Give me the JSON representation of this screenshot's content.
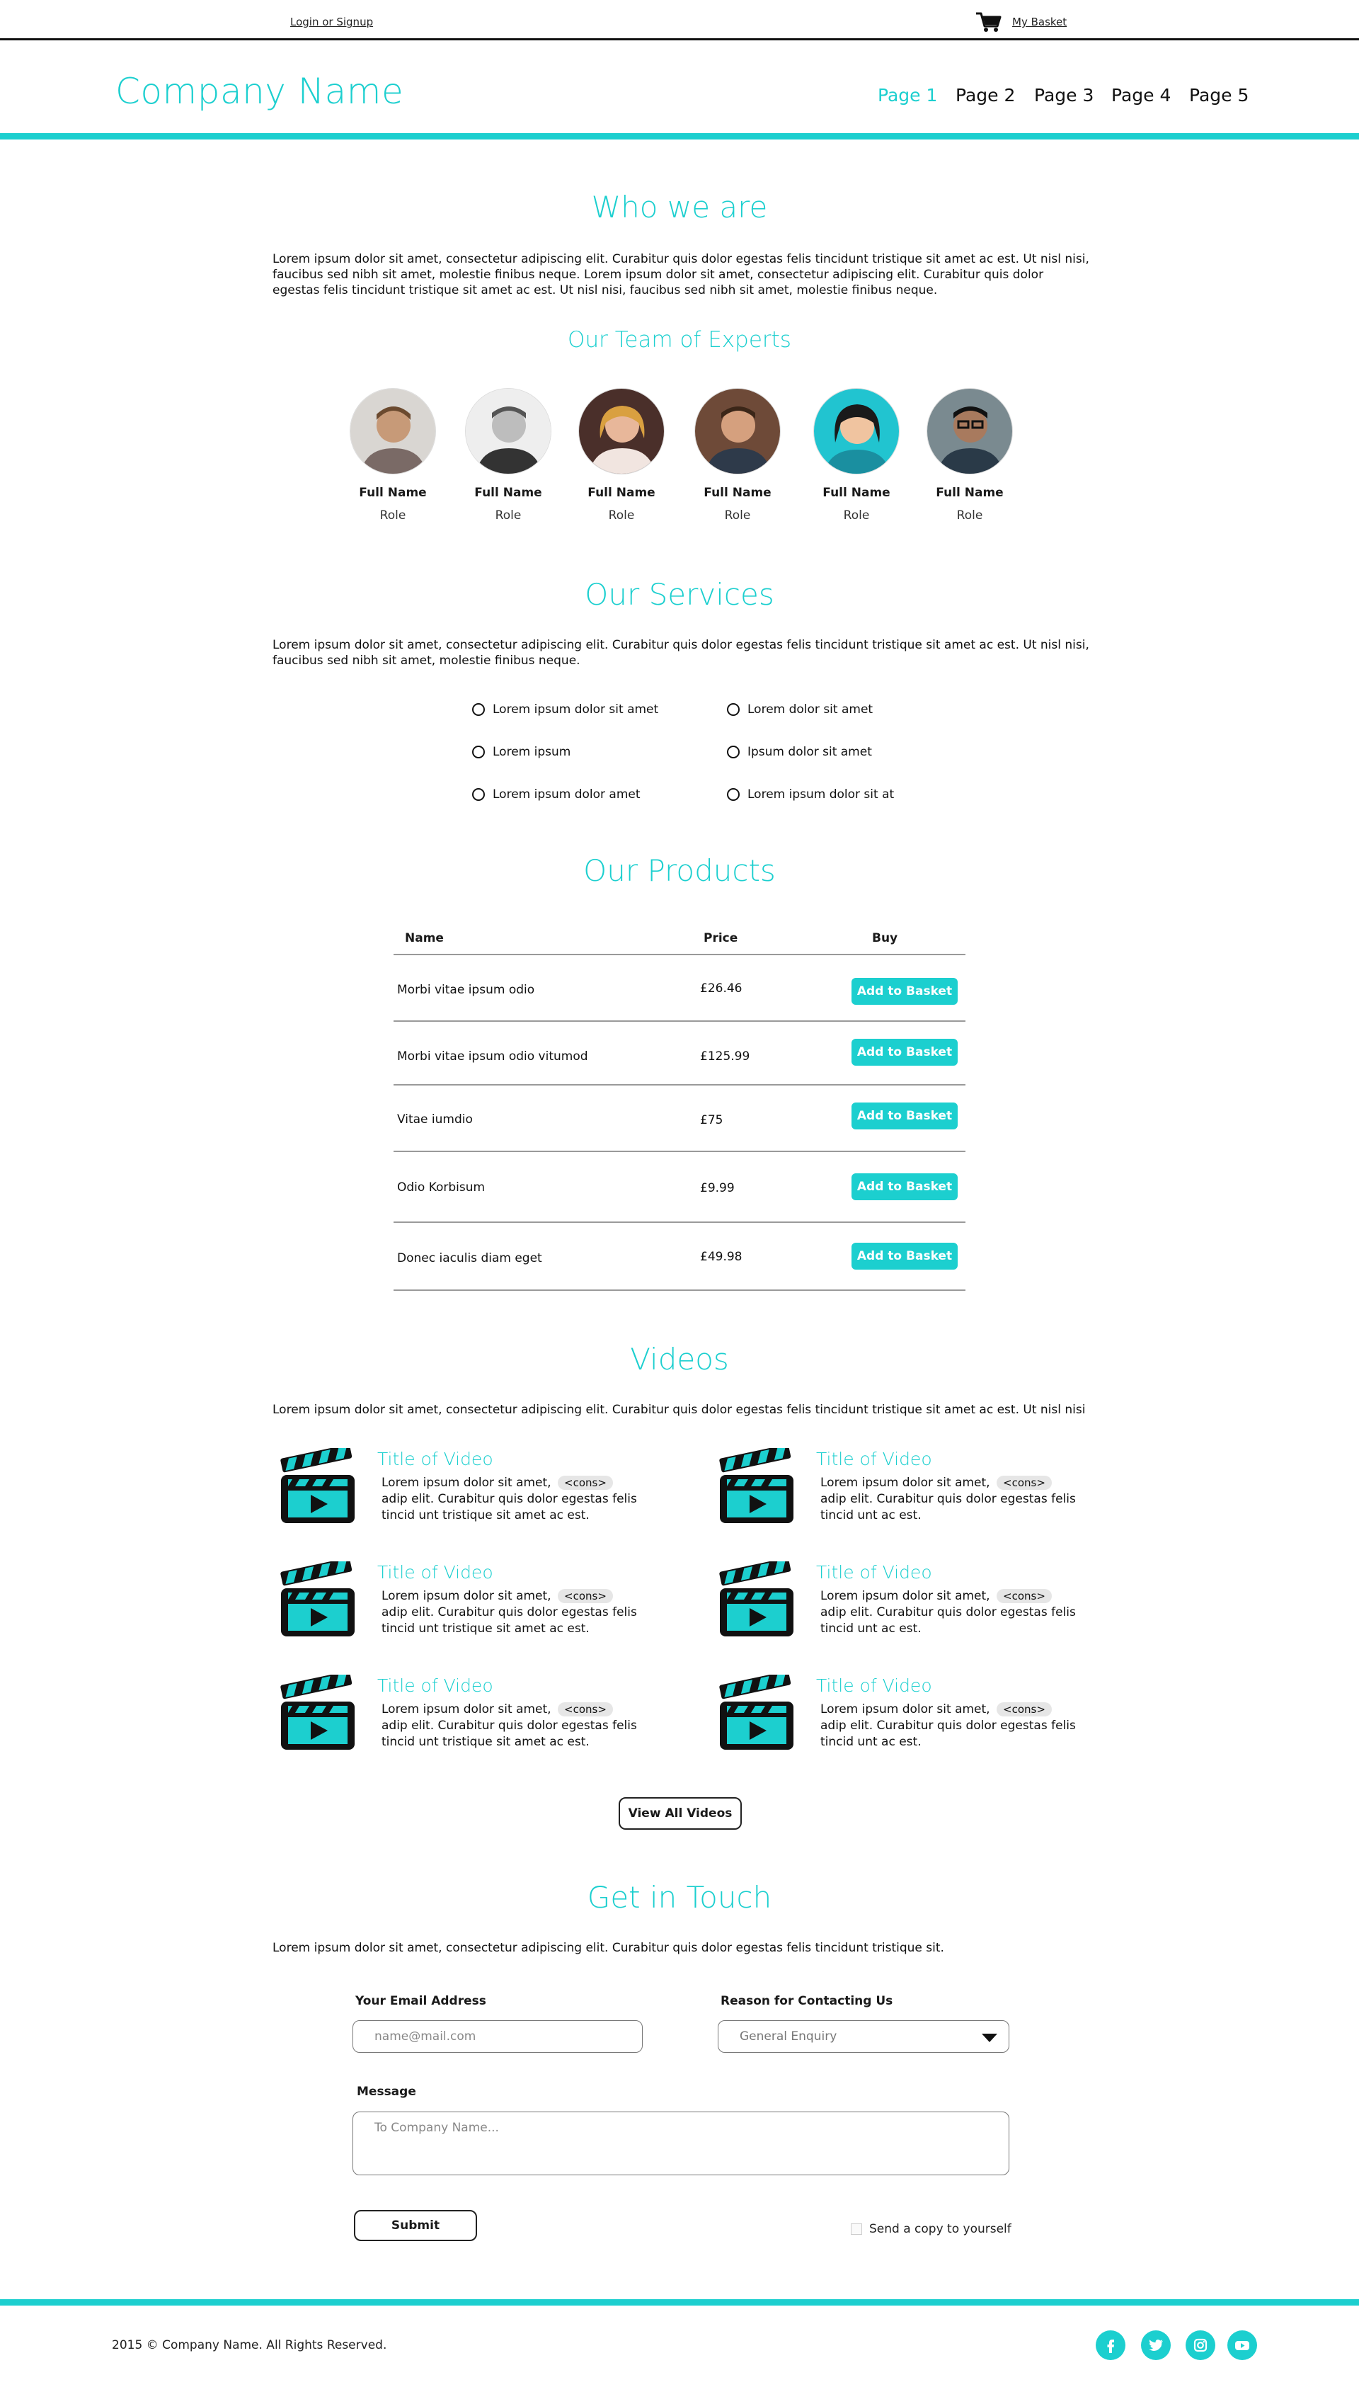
{
  "topbar": {
    "login": "Login or Signup",
    "basket": "My Basket"
  },
  "header": {
    "company": "Company Name",
    "nav": [
      "Page 1",
      "Page 2",
      "Page 3",
      "Page 4",
      "Page 5"
    ],
    "active_nav": "Page 1"
  },
  "about": {
    "title": "Who we are",
    "text": "Lorem ipsum dolor sit amet, consectetur adipiscing elit. Curabitur quis dolor egestas felis tincidunt tristique sit amet ac est. Ut nisl nisi, faucibus sed nibh sit amet, molestie finibus neque. Lorem ipsum dolor sit amet, consectetur adipiscing elit. Curabitur quis dolor egestas felis tincidunt tristique sit amet ac est. Ut nisl nisi, faucibus sed nibh sit amet, molestie finibus neque."
  },
  "team": {
    "title": "Our Team of Experts",
    "members": [
      {
        "name": "Full Name",
        "role": "Role"
      },
      {
        "name": "Full Name",
        "role": "Role"
      },
      {
        "name": "Full Name",
        "role": "Role"
      },
      {
        "name": "Full Name",
        "role": "Role"
      },
      {
        "name": "Full Name",
        "role": "Role"
      },
      {
        "name": "Full Name",
        "role": "Role"
      }
    ]
  },
  "services": {
    "title": "Our Services",
    "text": "Lorem ipsum dolor sit amet, consectetur adipiscing elit. Curabitur quis dolor egestas felis tincidunt tristique sit amet ac est. Ut nisl nisi, faucibus sed nibh sit amet, molestie finibus neque.",
    "items": [
      "Lorem ipsum dolor sit amet",
      "Lorem dolor sit amet",
      "Lorem ipsum",
      "Ipsum dolor sit amet",
      "Lorem ipsum dolor amet",
      "Lorem ipsum dolor sit at"
    ]
  },
  "products": {
    "title": "Our Products",
    "headers": {
      "name": "Name",
      "price": "Price",
      "buy": "Buy"
    },
    "button": "Add to Basket",
    "rows": [
      {
        "name": "Morbi vitae ipsum odio",
        "price": "£26.46"
      },
      {
        "name": "Morbi vitae ipsum odio vitumod",
        "price": "£125.99"
      },
      {
        "name": "Vitae iumdio",
        "price": "£75"
      },
      {
        "name": "Odio Korbisum",
        "price": "£9.99"
      },
      {
        "name": "Donec iaculis diam eget",
        "price": "£49.98"
      }
    ]
  },
  "videos": {
    "title": "Videos",
    "text": "Lorem ipsum dolor sit amet, consectetur adipiscing elit. Curabitur quis dolor egestas felis tincidunt tristique sit amet ac est. Ut nisl nisi",
    "tag": "<cons>",
    "items": [
      {
        "title": "Title of Video",
        "lead": "Lorem ipsum dolor sit amet,",
        "after": "adip",
        "rest": "elit. Curabitur quis dolor egestas felis tincid unt tristique sit amet ac est."
      },
      {
        "title": "Title of Video",
        "lead": "Lorem ipsum dolor sit amet,",
        "after": "adip",
        "rest": "elit. Curabitur quis dolor egestas felis tincid unt ac est."
      },
      {
        "title": "Title of Video",
        "lead": "Lorem ipsum dolor sit amet,",
        "after": "adip",
        "rest": "elit. Curabitur quis dolor egestas felis tincid unt tristique sit amet ac est."
      },
      {
        "title": "Title of Video",
        "lead": "Lorem ipsum dolor sit amet,",
        "after": "adip",
        "rest": "elit. Curabitur quis dolor egestas felis tincid unt ac est."
      },
      {
        "title": "Title of Video",
        "lead": "Lorem ipsum dolor sit amet,",
        "after": "adip",
        "rest": "elit. Curabitur quis dolor egestas felis tincid unt tristique sit amet ac est."
      },
      {
        "title": "Title of Video",
        "lead": "Lorem ipsum dolor sit amet,",
        "after": "adip",
        "rest": "elit. Curabitur quis dolor egestas felis tincid unt ac est."
      }
    ],
    "view_all": "View All Videos"
  },
  "contact": {
    "title": "Get in Touch",
    "text": "Lorem ipsum dolor sit amet, consectetur adipiscing elit. Curabitur quis dolor egestas felis tincidunt tristique sit.",
    "email_label": "Your Email Address",
    "email_placeholder": "name@mail.com",
    "reason_label": "Reason for Contacting Us",
    "reason_value": "General Enquiry",
    "message_label": "Message",
    "message_placeholder": "To Company Name...",
    "submit": "Submit",
    "copy_label": "Send a copy to yourself"
  },
  "footer": {
    "copyright": "2015 © Company Name. All Rights Reserved.",
    "social": [
      "facebook-icon",
      "twitter-icon",
      "instagram-icon",
      "youtube-icon"
    ]
  },
  "colors": {
    "accent": "#1ccfcf",
    "text": "#1a1a1a"
  }
}
